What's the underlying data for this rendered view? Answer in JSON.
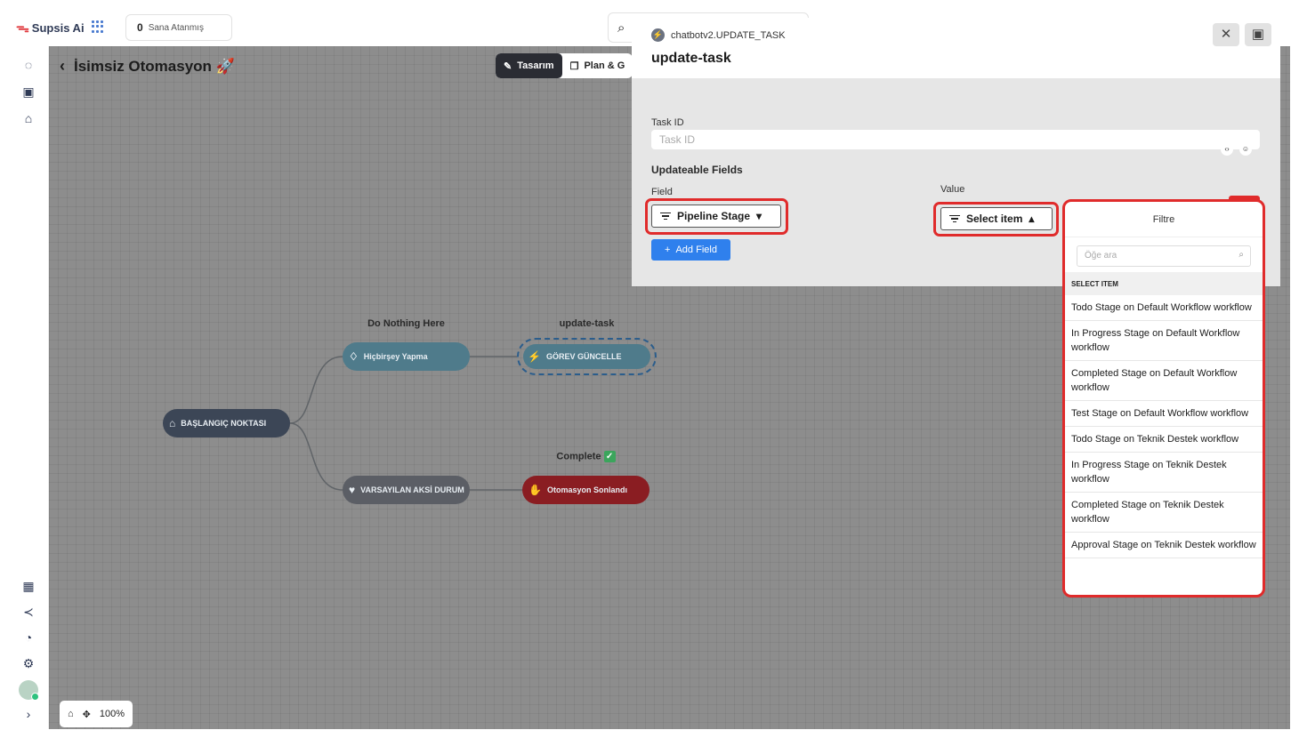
{
  "app": {
    "name": "Supsis Ai"
  },
  "topbar": {
    "assigned_count": "0",
    "assigned_label": "Sana Atanmış"
  },
  "canvas": {
    "title": "İsimsiz Otomasyon 🚀",
    "tabs": [
      {
        "label": "Tasarım",
        "active": true
      },
      {
        "label": "Plan & G",
        "active": false
      }
    ],
    "zoom": "100%",
    "nodes": {
      "start": "BAŞLANGIÇ NOKTASI",
      "nothing_caption": "Do Nothing Here",
      "nothing": "Hiçbirşey Yapma",
      "update_caption": "update-task",
      "update": "GÖREV GÜNCELLE",
      "default": "VARSAYILAN AKSİ DURUM",
      "complete_caption": "Complete",
      "end": "Otomasyon Sonlandı"
    }
  },
  "panel": {
    "subtitle": "chatbotv2.UPDATE_TASK",
    "title": "update-task",
    "task_id_label": "Task ID",
    "task_id_placeholder": "Task ID",
    "updateable_label": "Updateable Fields",
    "field_label": "Field",
    "field_value": "Pipeline Stage",
    "value_label": "Value",
    "value_select": "Select item",
    "add_field": "Add Field"
  },
  "menu": {
    "header": "Filtre",
    "search_placeholder": "Öğe ara",
    "section": "SELECT ITEM",
    "items": [
      "Todo Stage on Default Workflow workflow",
      "In Progress Stage on Default Workflow workflow",
      "Completed Stage on Default Workflow workflow",
      "Test Stage on Default Workflow workflow",
      "Todo Stage on Teknik Destek workflow",
      "In Progress Stage on Teknik Destek workflow",
      "Completed Stage on Teknik Destek workflow",
      "Approval Stage on Teknik Destek workflow"
    ]
  },
  "colors": {
    "highlight": "#e02b2b",
    "primary": "#2f80ed",
    "canvas": "#8d8d8d"
  }
}
